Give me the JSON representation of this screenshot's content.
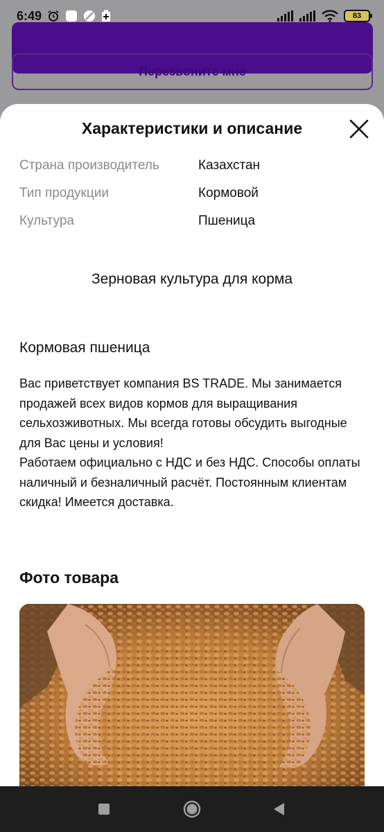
{
  "status_bar": {
    "time": "6:49",
    "battery_level": "83",
    "left_icons": [
      "alarm-icon",
      "app-notification-icon",
      "restricted-icon",
      "battery-saver-icon"
    ],
    "right_icons": [
      "signal-icon",
      "signal-icon-2",
      "wifi-icon",
      "battery-icon"
    ]
  },
  "background_page": {
    "buy_button_color": "#4a0e8c",
    "callback_button_label": "Перезвоните мне"
  },
  "sheet": {
    "title": "Характеристики и описание",
    "close_icon": "close-icon",
    "specs": [
      {
        "label": "Страна производитель",
        "value": "Казахстан"
      },
      {
        "label": "Тип продукции",
        "value": "Кормовой"
      },
      {
        "label": "Культура",
        "value": "Пшеница"
      }
    ],
    "subtitle": "Зерновая культура для корма",
    "product_name": "Кормовая пшеница",
    "description": "Вас приветствует компания BS TRADE.  Мы занимается продажей всех видов кормов для выращивания сельхозживотных. Мы всегда готовы обсудить выгодные для Вас цены и условия!\n    Работаем официально с НДС и без НДС. Способы оплаты наличный и безналичный расчёт. Постоянным клиентам скидка! Имеется доставка.",
    "photo_heading": "Фото товара"
  },
  "nav_bar": {
    "buttons": [
      "recents-icon",
      "home-icon",
      "back-icon"
    ]
  },
  "colors": {
    "accent": "#4a0e8c",
    "overlay": "#9a9a9d",
    "label_gray": "#8a8a8a"
  }
}
